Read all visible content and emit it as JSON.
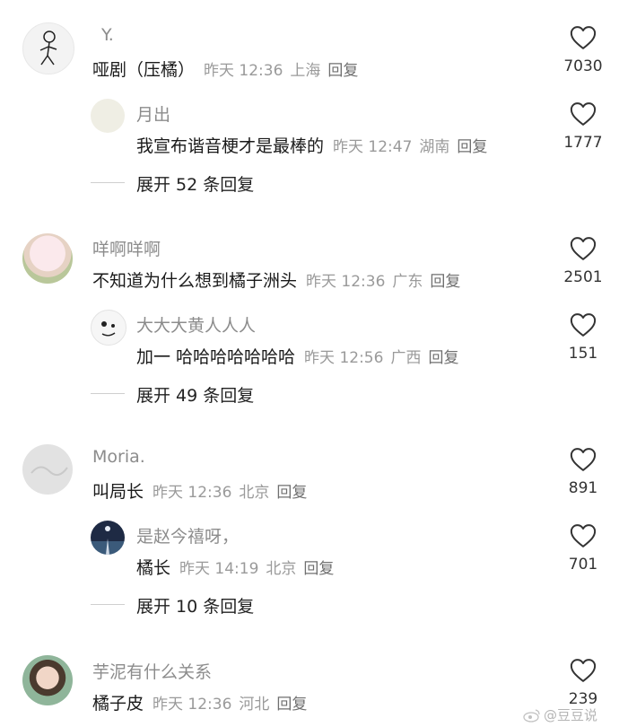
{
  "comments": [
    {
      "user": "Y.",
      "text": "哑剧（压橘）",
      "time": "昨天 12:36",
      "location": "上海",
      "reply": "回复",
      "likes": "7030",
      "replies": [
        {
          "user": "月出",
          "text": "我宣布谐音梗才是最棒的",
          "time": "昨天 12:47",
          "location": "湖南",
          "reply": "回复",
          "likes": "1777"
        }
      ],
      "expand": "展开 52 条回复"
    },
    {
      "user": "咩啊咩啊",
      "text": "不知道为什么想到橘子洲头",
      "time": "昨天 12:36",
      "location": "广东",
      "reply": "回复",
      "likes": "2501",
      "replies": [
        {
          "user": "大大大黄人人人",
          "text": "加一 哈哈哈哈哈哈哈",
          "time": "昨天 12:56",
          "location": "广西",
          "reply": "回复",
          "likes": "151"
        }
      ],
      "expand": "展开 49 条回复"
    },
    {
      "user": "Moria.",
      "text": "叫局长",
      "time": "昨天 12:36",
      "location": "北京",
      "reply": "回复",
      "likes": "891",
      "replies": [
        {
          "user": "是赵今禧呀，",
          "text": "橘长",
          "time": "昨天 14:19",
          "location": "北京",
          "reply": "回复",
          "likes": "701"
        }
      ],
      "expand": "展开 10 条回复"
    },
    {
      "user": "芋泥有什么关系",
      "text": "橘子皮",
      "time": "昨天 12:36",
      "location": "河北",
      "reply": "回复",
      "likes": "239",
      "replies": []
    }
  ],
  "watermark": "@豆豆说",
  "icons": {
    "like": "heart-outline-icon",
    "weibo": "weibo-logo-icon"
  },
  "colors": {
    "name": "#8c8c8c",
    "meta": "#9a9a9a",
    "text": "#1a1a1a"
  }
}
